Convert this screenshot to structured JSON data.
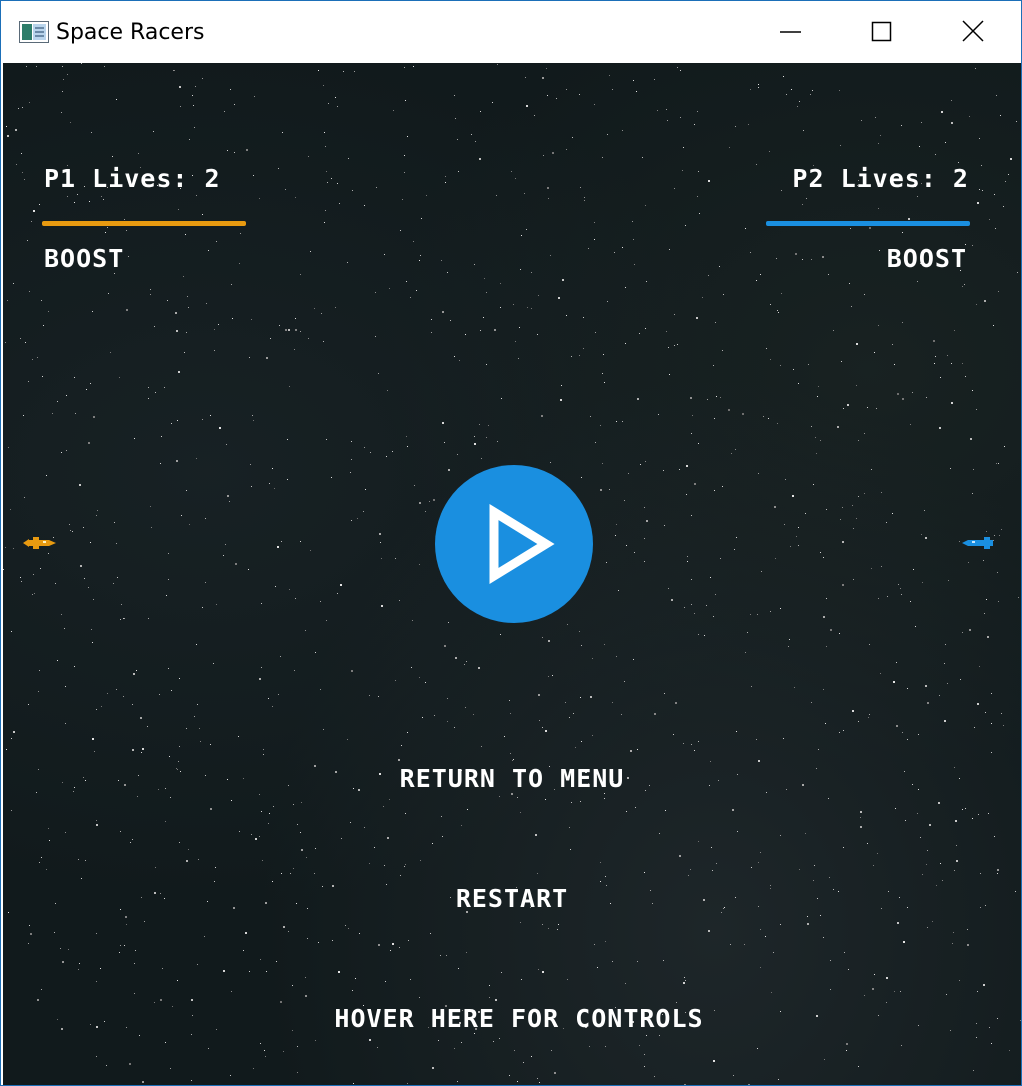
{
  "window": {
    "title": "Space Racers",
    "controls": [
      "minimize-icon",
      "maximize-icon",
      "close-icon"
    ]
  },
  "hud": {
    "p1": {
      "lives_label": "P1 Lives: 2",
      "boost_label": "BOOST",
      "color": "#e89a10",
      "boost_level": 1.0
    },
    "p2": {
      "lives_label": "P2 Lives: 2",
      "boost_label": "BOOST",
      "color": "#1a8fe0",
      "boost_level": 1.0
    }
  },
  "pause_menu": {
    "play_icon": "play-icon",
    "play_color": "#1a8fe0",
    "items": {
      "return": "RETURN TO MENU",
      "restart": "RESTART",
      "controls": "HOVER HERE FOR CONTROLS"
    }
  },
  "ships": {
    "p1": "orange-ship-icon",
    "p2": "blue-ship-icon"
  }
}
